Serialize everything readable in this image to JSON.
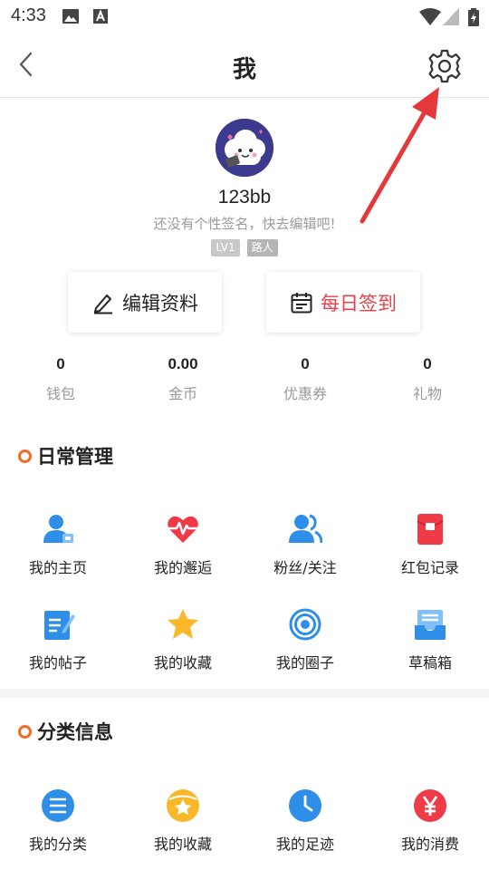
{
  "status_bar": {
    "time": "4:33",
    "icons": [
      "image-icon",
      "a-icon",
      "wifi-icon",
      "signal-icon",
      "battery-icon"
    ]
  },
  "header": {
    "title": "我",
    "back_icon": "chevron-left-icon",
    "settings_icon": "gear-icon"
  },
  "profile": {
    "username": "123bb",
    "signature": "还没有个性签名，快去编辑吧!",
    "level_badge": "LV1",
    "rank_badge": "路人"
  },
  "actions": {
    "edit_label": "编辑资料",
    "checkin_label": "每日签到"
  },
  "stats": [
    {
      "value": "0",
      "label": "钱包"
    },
    {
      "value": "0.00",
      "label": "金币"
    },
    {
      "value": "0",
      "label": "优惠券"
    },
    {
      "value": "0",
      "label": "礼物"
    }
  ],
  "daily": {
    "title": "日常管理",
    "items": [
      {
        "label": "我的主页",
        "icon": "user-home-icon"
      },
      {
        "label": "我的邂逅",
        "icon": "heart-pulse-icon"
      },
      {
        "label": "粉丝/关注",
        "icon": "followers-icon"
      },
      {
        "label": "红包记录",
        "icon": "red-envelope-icon"
      },
      {
        "label": "我的帖子",
        "icon": "post-edit-icon"
      },
      {
        "label": "我的收藏",
        "icon": "star-icon"
      },
      {
        "label": "我的圈子",
        "icon": "circle-target-icon"
      },
      {
        "label": "草稿箱",
        "icon": "drafts-tray-icon"
      }
    ]
  },
  "category": {
    "title": "分类信息",
    "items": [
      {
        "label": "我的分类",
        "icon": "list-icon"
      },
      {
        "label": "我的收藏",
        "icon": "star-badge-icon"
      },
      {
        "label": "我的足迹",
        "icon": "clock-icon"
      },
      {
        "label": "我的消费",
        "icon": "yen-icon"
      }
    ]
  },
  "colors": {
    "accent_red": "#e8404a",
    "section_dot": "#f26b21",
    "icon_blue": "#2f8fe8"
  }
}
